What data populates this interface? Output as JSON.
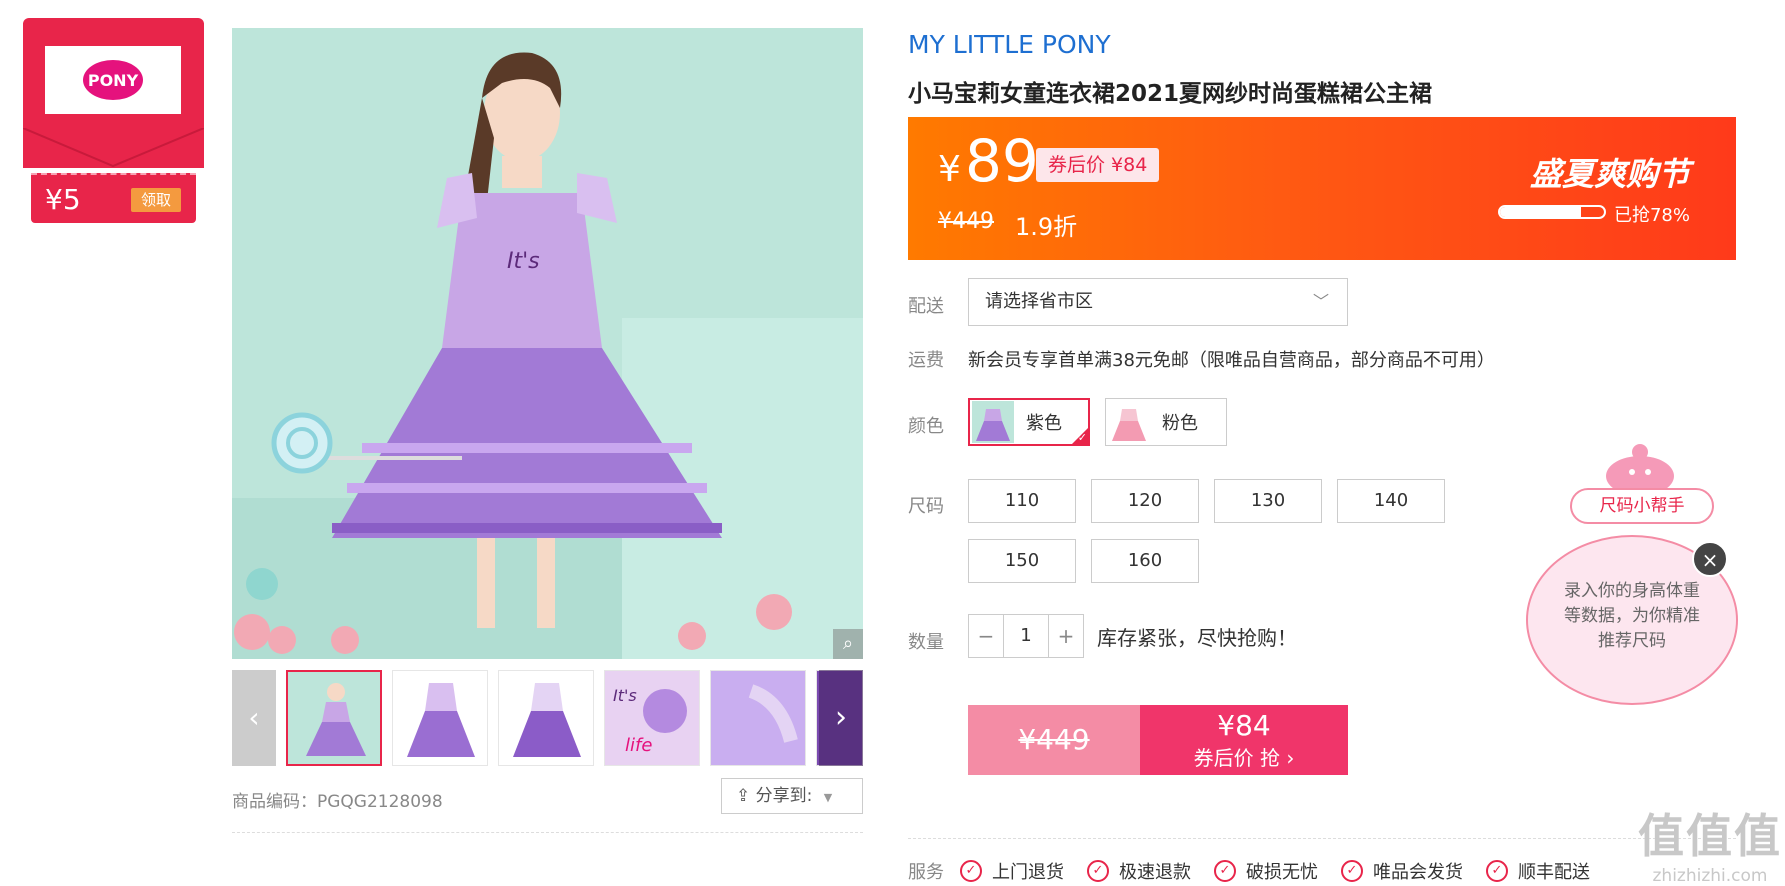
{
  "coupon": {
    "amount": "¥5",
    "claim_label": "领取",
    "brand_logo": "my-little-pony-logo",
    "logo_text": "MY LITTLE PONY"
  },
  "gallery": {
    "zoom_icon": "magnifier-icon",
    "prev_icon": "‹",
    "next_icon": "›",
    "sku_code": "商品编码：PGQG2128098",
    "share_label": "分享到:"
  },
  "product": {
    "brand": "MY LITTLE PONY",
    "title": "小马宝莉女童连衣裙2021夏网纱时尚蛋糕裙公主裙"
  },
  "price_bar": {
    "yen": "¥",
    "price": "89",
    "after_coupon": "券后价 ¥84",
    "original": "¥449",
    "discount": "1.9折",
    "event_name": "盛夏爽购节",
    "sold_text": "已抢78%",
    "sold_fraction": 0.78
  },
  "delivery": {
    "label": "配送",
    "placeholder": "请选择省市区",
    "chevron": "﹀"
  },
  "shipping": {
    "label": "运费",
    "text": "新会员专享首单满38元免邮（限唯品自营商品，部分商品不可用）"
  },
  "color": {
    "label": "颜色",
    "options": [
      {
        "name": "紫色",
        "selected": true
      },
      {
        "name": "粉色",
        "selected": false
      }
    ]
  },
  "size": {
    "label": "尺码",
    "options": [
      "110",
      "120",
      "130",
      "140",
      "150",
      "160"
    ]
  },
  "quantity": {
    "label": "数量",
    "minus": "−",
    "value": "1",
    "plus": "+",
    "stock_text": "库存紧张，尽快抢购！"
  },
  "buy": {
    "original": "¥449",
    "price": "¥84",
    "sub": "券后价 抢 ›"
  },
  "service": {
    "label": "服务",
    "items": [
      "上门退货",
      "极速退款",
      "破损无忧",
      "唯品会发货",
      "顺丰配送"
    ]
  },
  "size_helper": {
    "title": "尺码小帮手",
    "text": "录入你的身高体重等数据，为你精准推荐尺码",
    "close": "×"
  },
  "watermark": {
    "chars": "值值值",
    "url": "zhizhizhi.com"
  },
  "colors": {
    "accent": "#e8254a",
    "brand_blue": "#1e6fd1",
    "price_orange": "#ff5a12"
  }
}
